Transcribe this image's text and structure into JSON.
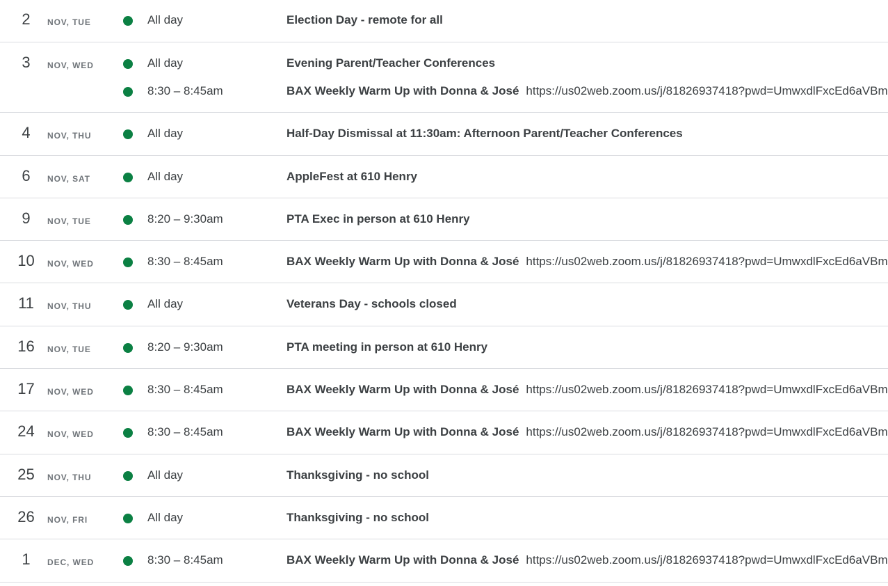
{
  "colors": {
    "event_dot": "#0b8043",
    "divider": "#dadce0",
    "text": "#3c4043",
    "muted": "#70757a"
  },
  "icons": {
    "event_dot": "event-color-dot-icon"
  },
  "days": [
    {
      "day": "2",
      "label": "NOV, TUE",
      "events": [
        {
          "time": "All day",
          "title": "Election Day - remote for all",
          "desc": ""
        }
      ]
    },
    {
      "day": "3",
      "label": "NOV, WED",
      "events": [
        {
          "time": "All day",
          "title": "Evening Parent/Teacher Conferences",
          "desc": ""
        },
        {
          "time": "8:30 – 8:45am",
          "title": "BAX Weekly Warm Up with Donna & José",
          "desc": "https://us02web.zoom.us/j/81826937418?pwd=UmwxdlFxcEd6aVBm"
        }
      ]
    },
    {
      "day": "4",
      "label": "NOV, THU",
      "events": [
        {
          "time": "All day",
          "title": "Half-Day Dismissal at 11:30am: Afternoon Parent/Teacher Conferences",
          "desc": ""
        }
      ]
    },
    {
      "day": "6",
      "label": "NOV, SAT",
      "events": [
        {
          "time": "All day",
          "title": "AppleFest at 610 Henry",
          "desc": ""
        }
      ]
    },
    {
      "day": "9",
      "label": "NOV, TUE",
      "events": [
        {
          "time": "8:20 – 9:30am",
          "title": "PTA Exec in person at 610 Henry",
          "desc": ""
        }
      ]
    },
    {
      "day": "10",
      "label": "NOV, WED",
      "events": [
        {
          "time": "8:30 – 8:45am",
          "title": "BAX Weekly Warm Up with Donna & José",
          "desc": "https://us02web.zoom.us/j/81826937418?pwd=UmwxdlFxcEd6aVBm"
        }
      ]
    },
    {
      "day": "11",
      "label": "NOV, THU",
      "events": [
        {
          "time": "All day",
          "title": "Veterans Day - schools closed",
          "desc": ""
        }
      ]
    },
    {
      "day": "16",
      "label": "NOV, TUE",
      "events": [
        {
          "time": "8:20 – 9:30am",
          "title": "PTA meeting in person at 610 Henry",
          "desc": ""
        }
      ]
    },
    {
      "day": "17",
      "label": "NOV, WED",
      "events": [
        {
          "time": "8:30 – 8:45am",
          "title": "BAX Weekly Warm Up with Donna & José",
          "desc": "https://us02web.zoom.us/j/81826937418?pwd=UmwxdlFxcEd6aVBm"
        }
      ]
    },
    {
      "day": "24",
      "label": "NOV, WED",
      "events": [
        {
          "time": "8:30 – 8:45am",
          "title": "BAX Weekly Warm Up with Donna & José",
          "desc": "https://us02web.zoom.us/j/81826937418?pwd=UmwxdlFxcEd6aVBm"
        }
      ]
    },
    {
      "day": "25",
      "label": "NOV, THU",
      "events": [
        {
          "time": "All day",
          "title": "Thanksgiving - no school",
          "desc": ""
        }
      ]
    },
    {
      "day": "26",
      "label": "NOV, FRI",
      "events": [
        {
          "time": "All day",
          "title": "Thanksgiving - no school",
          "desc": ""
        }
      ]
    },
    {
      "day": "1",
      "label": "DEC, WED",
      "events": [
        {
          "time": "8:30 – 8:45am",
          "title": "BAX Weekly Warm Up with Donna & José",
          "desc": "https://us02web.zoom.us/j/81826937418?pwd=UmwxdlFxcEd6aVBm"
        }
      ]
    }
  ]
}
